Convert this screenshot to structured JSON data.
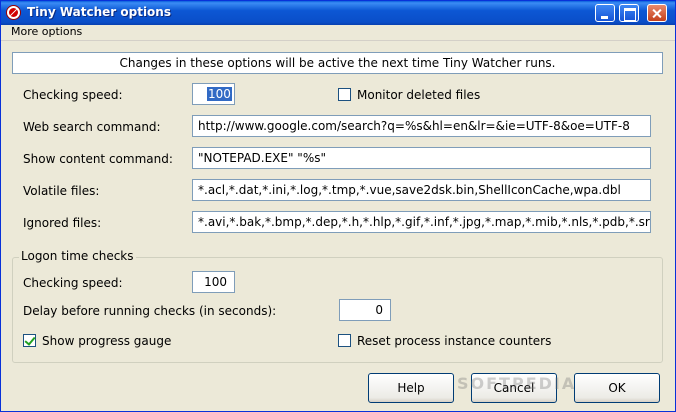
{
  "window": {
    "title": "Tiny Watcher options"
  },
  "menu": {
    "more_options": "More options"
  },
  "notice": "Changes in these options will be active the next time Tiny Watcher runs.",
  "fields": {
    "checking_speed_label": "Checking speed:",
    "checking_speed_value": "100",
    "monitor_deleted_label": "Monitor deleted files",
    "monitor_deleted_checked": false,
    "web_search_label": "Web search command:",
    "web_search_value": "http://www.google.com/search?q=%s&hl=en&lr=&ie=UTF-8&oe=UTF-8",
    "show_content_label": "Show content command:",
    "show_content_value": "\"NOTEPAD.EXE\" \"%s\"",
    "volatile_label": "Volatile files:",
    "volatile_value": "*.acl,*.dat,*.ini,*.log,*.tmp,*.vue,save2dsk.bin,ShellIconCache,wpa.dbl",
    "ignored_label": "Ignored files:",
    "ignored_value": "*.avi,*.bak,*.bmp,*.dep,*.h,*.hlp,*.gif,*.inf,*.jpg,*.map,*.mib,*.nls,*.pdb,*.sr"
  },
  "logon": {
    "legend": "Logon time checks",
    "checking_speed_label": "Checking speed:",
    "checking_speed_value": "100",
    "delay_label": "Delay before running checks (in seconds):",
    "delay_value": "0",
    "show_progress_label": "Show progress gauge",
    "show_progress_checked": true,
    "reset_counters_label": "Reset process instance counters",
    "reset_counters_checked": false
  },
  "buttons": {
    "help": "Help",
    "cancel": "Cancel",
    "ok": "OK"
  },
  "watermark": "SOFTPEDIA"
}
